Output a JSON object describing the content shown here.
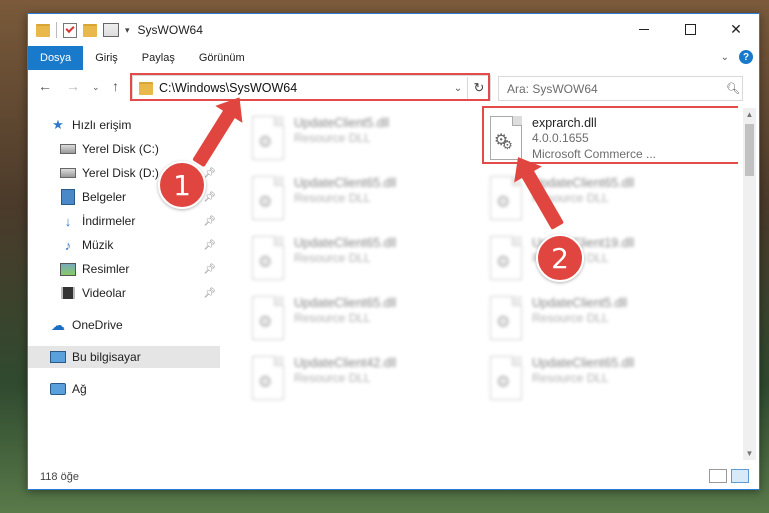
{
  "window": {
    "title": "SysWOW64"
  },
  "ribbon": {
    "tabs": [
      "Dosya",
      "Giriş",
      "Paylaş",
      "Görünüm"
    ]
  },
  "nav": {
    "address": "C:\\Windows\\SysWOW64",
    "search_placeholder": "Ara: SysWOW64"
  },
  "sidebar": {
    "items": [
      {
        "label": "Hızlı erişim",
        "icon": "star-icon"
      },
      {
        "label": "Yerel Disk (C:)",
        "icon": "drive-icon"
      },
      {
        "label": "Yerel Disk (D:)",
        "icon": "drive-icon"
      },
      {
        "label": "Belgeler",
        "icon": "documents-icon"
      },
      {
        "label": "İndirmeler",
        "icon": "download-icon"
      },
      {
        "label": "Müzik",
        "icon": "music-icon"
      },
      {
        "label": "Resimler",
        "icon": "pictures-icon"
      },
      {
        "label": "Videolar",
        "icon": "videos-icon"
      },
      {
        "label": "OneDrive",
        "icon": "cloud-icon"
      },
      {
        "label": "Bu bilgisayar",
        "icon": "computer-icon"
      },
      {
        "label": "Ağ",
        "icon": "network-icon"
      }
    ]
  },
  "files": [
    {
      "name": "UpdateClient5.dll",
      "meta1": "Resource DLL",
      "meta2": ""
    },
    {
      "name": "exprarch.dll",
      "meta1": "4.0.0.1655",
      "meta2": "Microsoft Commerce ..."
    },
    {
      "name": "UpdateClient65.dll",
      "meta1": "Resource DLL",
      "meta2": ""
    },
    {
      "name": "UpdateClient65.dll",
      "meta1": "Resource DLL",
      "meta2": ""
    },
    {
      "name": "UpdateClient65.dll",
      "meta1": "Resource DLL",
      "meta2": ""
    },
    {
      "name": "UpdateClient19.dll",
      "meta1": "Resource DLL",
      "meta2": ""
    },
    {
      "name": "UpdateClient65.dll",
      "meta1": "Resource DLL",
      "meta2": ""
    },
    {
      "name": "UpdateClient5.dll",
      "meta1": "Resource DLL",
      "meta2": ""
    },
    {
      "name": "UpdateClient42.dll",
      "meta1": "Resource DLL",
      "meta2": ""
    },
    {
      "name": "UpdateClient65.dll",
      "meta1": "Resource DLL",
      "meta2": ""
    }
  ],
  "annotations": {
    "badge1": "1",
    "badge2": "2",
    "color": "#e0463f"
  },
  "status": {
    "count": "118 öğe"
  }
}
